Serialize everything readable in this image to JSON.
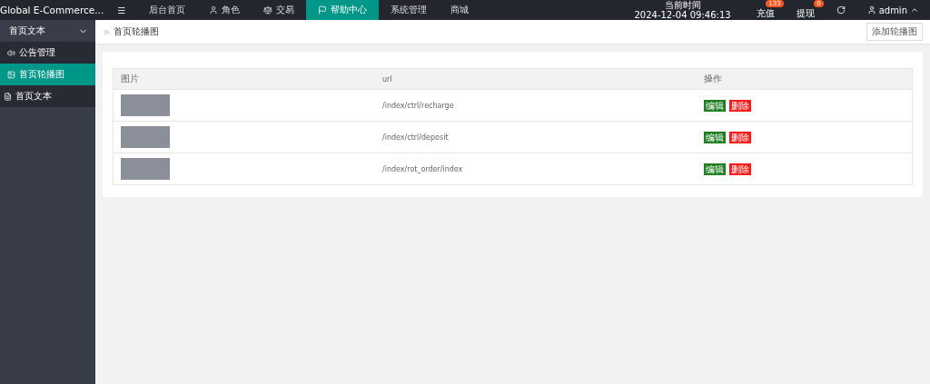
{
  "header": {
    "brand": "Global E-Commerce...",
    "menu_icon": "☰",
    "nav": [
      {
        "label": "后台首页",
        "selected": false
      },
      {
        "label": "角色",
        "selected": false
      },
      {
        "label": "交易",
        "selected": false
      },
      {
        "label": "帮助中心",
        "selected": true
      },
      {
        "label": "系统管理",
        "selected": false
      },
      {
        "label": "商城",
        "selected": false
      }
    ],
    "clock": {
      "label": "当前时间",
      "value": "2024-12-04 09:46:13"
    },
    "actions": [
      {
        "label": "充值",
        "badge": "133"
      },
      {
        "label": "提现",
        "badge": "0"
      }
    ],
    "user": "admin"
  },
  "sidebar": {
    "group": {
      "label": "首页文本",
      "expanded": true,
      "children": [
        {
          "label": "公告管理",
          "selected": false
        },
        {
          "label": "首页轮播图",
          "selected": true
        },
        {
          "label": "首页文本",
          "selected": false
        }
      ]
    }
  },
  "breadcrumb": "首页轮播图",
  "add_button": "添加轮播图",
  "table": {
    "columns": [
      "图片",
      "url",
      "操作"
    ],
    "rows": [
      {
        "url": "/index/ctrl/recharge",
        "actions": [
          "编辑",
          "删除"
        ]
      },
      {
        "url": "/index/ctrl/deposit",
        "actions": [
          "编辑",
          "删除"
        ]
      },
      {
        "url": "/index/rot_order/index",
        "actions": [
          "编辑",
          "删除"
        ]
      }
    ]
  }
}
